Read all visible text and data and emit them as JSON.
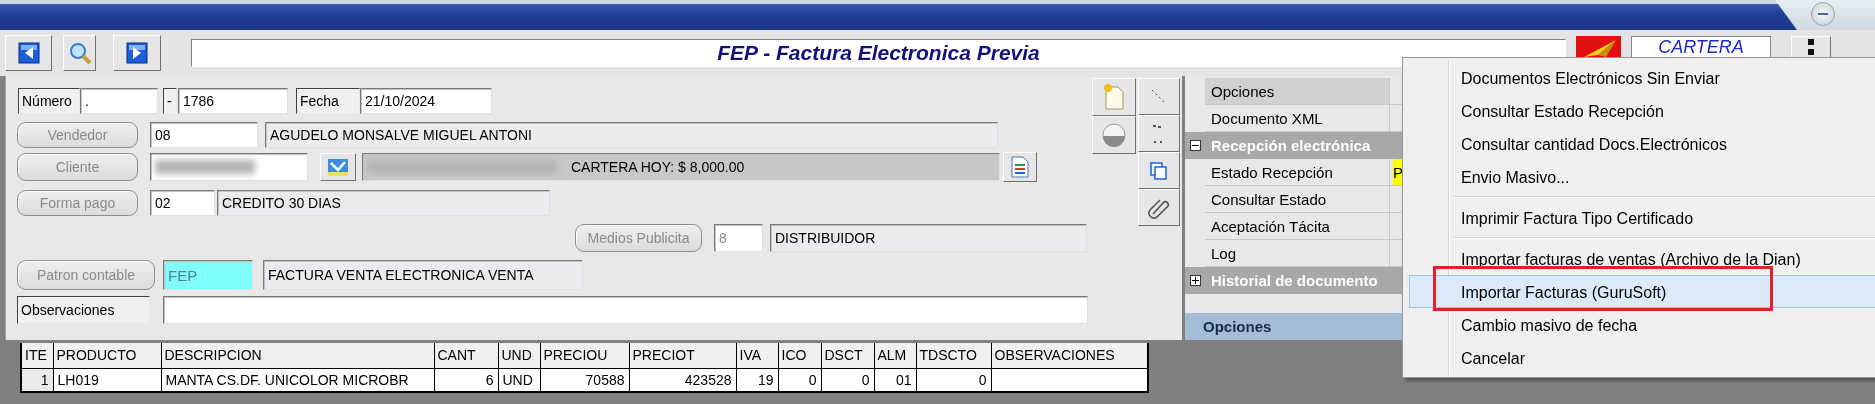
{
  "toolbar": {
    "title": "FEP - Factura Electronica Previa",
    "module": "CARTERA"
  },
  "form": {
    "numero": {
      "label": "Número",
      "prefix": ".",
      "separator": "-",
      "value": "1786"
    },
    "fecha": {
      "label": "Fecha",
      "value": "21/10/2024"
    },
    "vendedor": {
      "label": "Vendedor",
      "disabled": true,
      "code": "08",
      "name": "AGUDELO MONSALVE MIGUEL ANTONI"
    },
    "cliente": {
      "label": "Cliente",
      "disabled": true,
      "name": "CARTERA HOY: $ 8,000.00"
    },
    "forma_pago": {
      "label": "Forma pago",
      "disabled": true,
      "code": "02",
      "name": "CREDITO 30 DIAS"
    },
    "medios": {
      "label": "Medios Publicita",
      "disabled": true,
      "code": "8",
      "name": "DISTRIBUIDOR"
    },
    "patron": {
      "label": "Patron contable",
      "disabled": true,
      "code": "FEP",
      "name": "FACTURA VENTA ELECTRONICA VENTA"
    },
    "observaciones": {
      "label": "Observaciones"
    }
  },
  "properties": [
    {
      "kind": "property",
      "name": "Opciones",
      "selected": true
    },
    {
      "kind": "property",
      "name": "Documento XML",
      "selected": false
    },
    {
      "kind": "category",
      "name": "Recepción electrónica",
      "expanded": true
    },
    {
      "kind": "property",
      "name": "Estado Recepción",
      "selected": false,
      "value": "P"
    },
    {
      "kind": "property",
      "name": "Consultar Estado",
      "selected": false
    },
    {
      "kind": "property",
      "name": "Aceptación Tácita",
      "selected": false
    },
    {
      "kind": "property",
      "name": "Log",
      "selected": false
    },
    {
      "kind": "category",
      "name": "Historial de documento",
      "expanded": false
    }
  ],
  "properties_footer": "Opciones",
  "table": {
    "columns": [
      {
        "label": "ITE",
        "kind": "number"
      },
      {
        "label": "PRODUCTO",
        "kind": "text"
      },
      {
        "label": "DESCRIPCION",
        "kind": "text"
      },
      {
        "label": "CANT",
        "kind": "number"
      },
      {
        "label": "UND",
        "kind": "text"
      },
      {
        "label": "PRECIOU",
        "kind": "number"
      },
      {
        "label": "PRECIOT",
        "kind": "number"
      },
      {
        "label": "IVA",
        "kind": "number"
      },
      {
        "label": "ICO",
        "kind": "number"
      },
      {
        "label": "DSCT",
        "kind": "number"
      },
      {
        "label": "ALM",
        "kind": "number"
      },
      {
        "label": "TDSCTO",
        "kind": "number"
      },
      {
        "label": "OBSERVACIONES",
        "kind": "text"
      }
    ],
    "rows": [
      [
        "1",
        "LH019",
        "MANTA CS.DF. UNICOLOR MICROBR",
        "6",
        "UND",
        "70588",
        "423528",
        "19",
        "0",
        "0",
        "01",
        "0",
        ""
      ]
    ]
  },
  "context_menu": [
    {
      "kind": "item",
      "label": "Documentos Electrónicos Sin Enviar",
      "selected": false,
      "outlined": false
    },
    {
      "kind": "item",
      "label": "Consultar Estado Recepción",
      "selected": false,
      "outlined": false
    },
    {
      "kind": "item",
      "label": "Consultar cantidad Docs.Electrónicos",
      "selected": false,
      "outlined": false
    },
    {
      "kind": "item",
      "label": "Envio Masivo...",
      "selected": false,
      "outlined": false
    },
    {
      "kind": "separator"
    },
    {
      "kind": "item",
      "label": "Imprimir Factura Tipo Certificado",
      "selected": false,
      "outlined": false
    },
    {
      "kind": "separator"
    },
    {
      "kind": "item",
      "label": "Importar facturas de ventas (Archivo de la Dian)",
      "selected": false,
      "outlined": false
    },
    {
      "kind": "item",
      "label": "Importar Facturas (GuruSoft)",
      "selected": true,
      "outlined": true
    },
    {
      "kind": "item",
      "label": "Cambio masivo de fecha",
      "selected": false,
      "outlined": false
    },
    {
      "kind": "item",
      "label": "Cancelar",
      "selected": false,
      "outlined": false
    }
  ]
}
